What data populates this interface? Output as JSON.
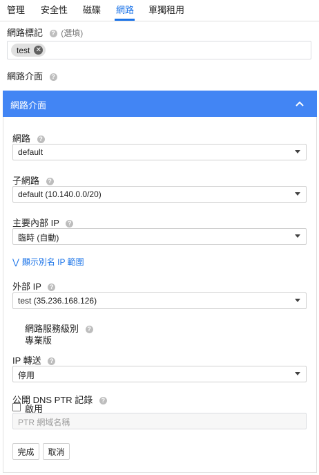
{
  "tabs": [
    {
      "label": "管理",
      "active": false
    },
    {
      "label": "安全性",
      "active": false
    },
    {
      "label": "磁碟",
      "active": false
    },
    {
      "label": "網路",
      "active": true
    },
    {
      "label": "單獨租用",
      "active": false
    }
  ],
  "network_tags": {
    "label": "網路標記",
    "optional": "(選填)",
    "tags": [
      "test"
    ]
  },
  "network_interface_heading": "網路介面",
  "panel": {
    "title": "網路介面",
    "network": {
      "label": "網路",
      "value": "default"
    },
    "subnet": {
      "label": "子網路",
      "value": "default (10.140.0.0/20)"
    },
    "primary_internal_ip": {
      "label": "主要內部 IP",
      "value": "臨時 (自動)"
    },
    "show_alias_link": "顯示別名 IP 範圍",
    "external_ip": {
      "label": "外部 IP",
      "value": "test (35.236.168.126)"
    },
    "network_service_tier": {
      "label": "網路服務級別",
      "value": "專業版"
    },
    "ip_forwarding": {
      "label": "IP 轉送",
      "value": "停用"
    },
    "public_dns_ptr": {
      "label": "公開 DNS PTR 記錄",
      "enable_label": "啟用",
      "enabled": false,
      "placeholder": "PTR 網域名稱"
    },
    "done_button": "完成",
    "cancel_button": "取消"
  },
  "colors": {
    "accent": "#1a73e8",
    "panel_header": "#4285f4"
  }
}
